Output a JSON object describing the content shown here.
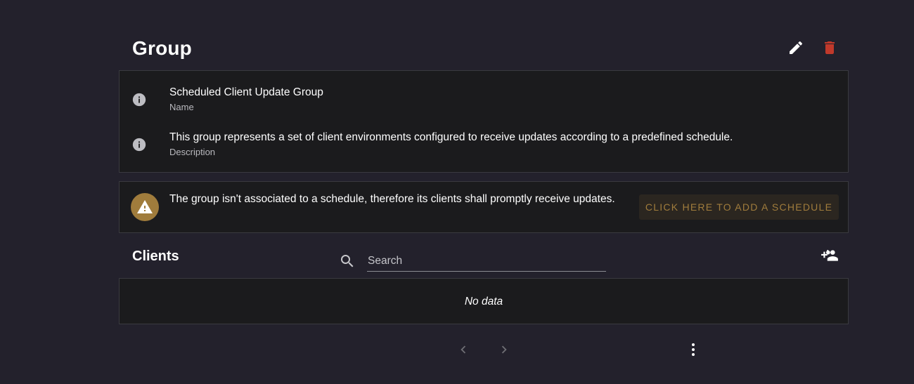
{
  "header": {
    "title": "Group"
  },
  "details": [
    {
      "value": "Scheduled Client Update Group",
      "label": "Name",
      "icon": "info-icon"
    },
    {
      "value": "This group represents a set of client environments configured to receive updates according to a predefined schedule.",
      "label": "Description",
      "icon": "info-icon"
    }
  ],
  "warning": {
    "message": "The group isn't associated to a schedule, therefore its clients shall promptly receive updates.",
    "action_label": "Click here to add a schedule",
    "icon": "warning-icon"
  },
  "clients": {
    "title": "Clients",
    "search_placeholder": "Search",
    "search_value": "",
    "empty_text": "No data"
  },
  "colors": {
    "background": "#23212c",
    "card": "#1b1b1d",
    "danger": "#c0392b",
    "warning": "#a07c3c"
  }
}
